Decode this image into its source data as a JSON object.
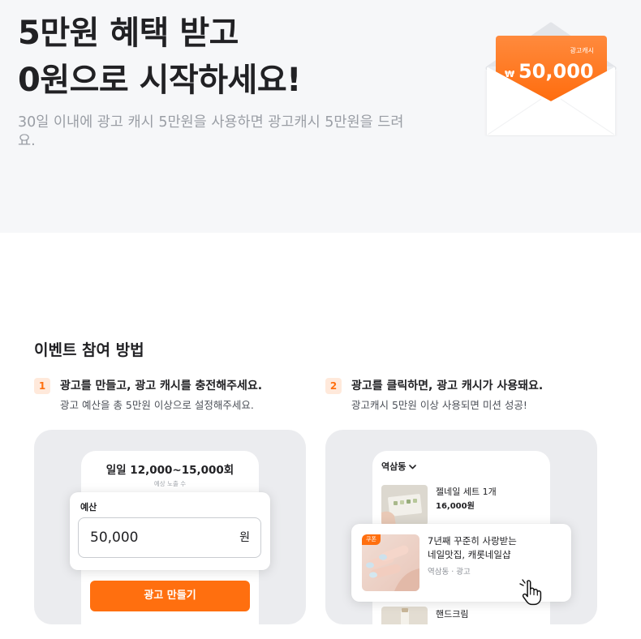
{
  "hero": {
    "title": [
      "5만원 혜택 받고",
      "0원으로 시작하세요!"
    ],
    "subtitle": "30일 이내에 광고 캐시 5만원을 사용하면 광고캐시 5만원을 드려요.",
    "envelope": {
      "label": "광고캐시",
      "currency": "₩",
      "amount": "50,000",
      "icon": "envelope-icon"
    }
  },
  "how_to": {
    "title": "이벤트 참여 방법",
    "steps": [
      {
        "number": "1",
        "title": "광고를 만들고, 광고 캐시를 충전해주세요.",
        "description": "광고 예산을 총 5만원 이상으로 설정해주세요."
      },
      {
        "number": "2",
        "title": "광고를 클릭하면, 광고 캐시가 사용돼요.",
        "description": "광고캐시 5만원 이상 사용되면 미션 성공!"
      }
    ]
  },
  "create_ad_preview": {
    "impressions": "일일 12,000~15,000회",
    "impressions_caption": "예상 노출 수",
    "budget_label": "예산",
    "budget_value": "50,000",
    "budget_unit": "원",
    "button_label": "광고 만들기"
  },
  "click_ad_preview": {
    "location": "역삼동",
    "location_icon": "chevron-down-icon",
    "items": [
      {
        "title": "젤네일 세트 1개",
        "price": "16,000원"
      },
      {
        "title": "핸드크림"
      }
    ],
    "promoted": {
      "badge": "쿠폰",
      "title_lines": [
        "7년째 꾸준히 사랑받는",
        "네일맛집, 캐롯네일샵"
      ],
      "meta": "역삼동 · 광고"
    },
    "cursor_icon": "hand-pointer-icon"
  },
  "colors": {
    "accent": "#ff6f0f",
    "hero_background": "#f6f7f9",
    "card_background": "#ebecef",
    "step_badge_background": "#ffe9db",
    "text_primary": "#212124",
    "text_secondary": "#9a9ea5"
  }
}
